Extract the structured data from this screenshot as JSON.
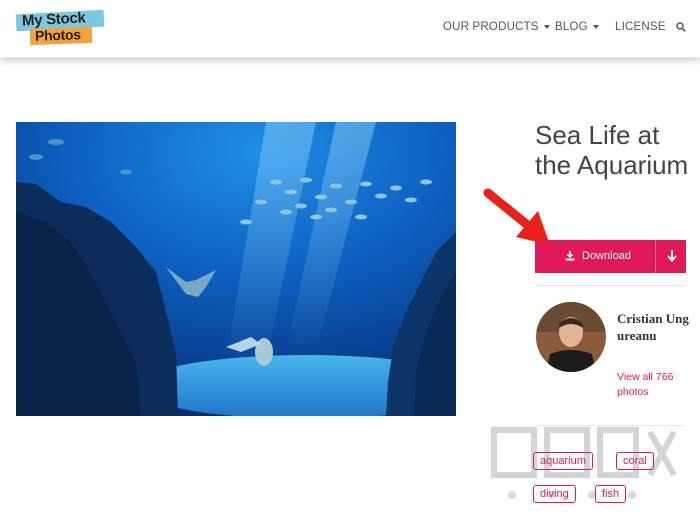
{
  "logo": {
    "line1": "My Stock",
    "line2": "Photos"
  },
  "nav": {
    "products": "OUR PRODUCTS",
    "blog": "BLOG",
    "license": "LICENSE"
  },
  "photo": {
    "title": "Sea Life at the Aquarium"
  },
  "download": {
    "label": "Download"
  },
  "author": {
    "name": "Cristian Ungureanu",
    "link": "View all 766 photos"
  },
  "tags": [
    "aquarium",
    "coral",
    "diving",
    "fish"
  ],
  "colors": {
    "accent": "#e0195a",
    "annotation_arrow": "#e8221b"
  }
}
